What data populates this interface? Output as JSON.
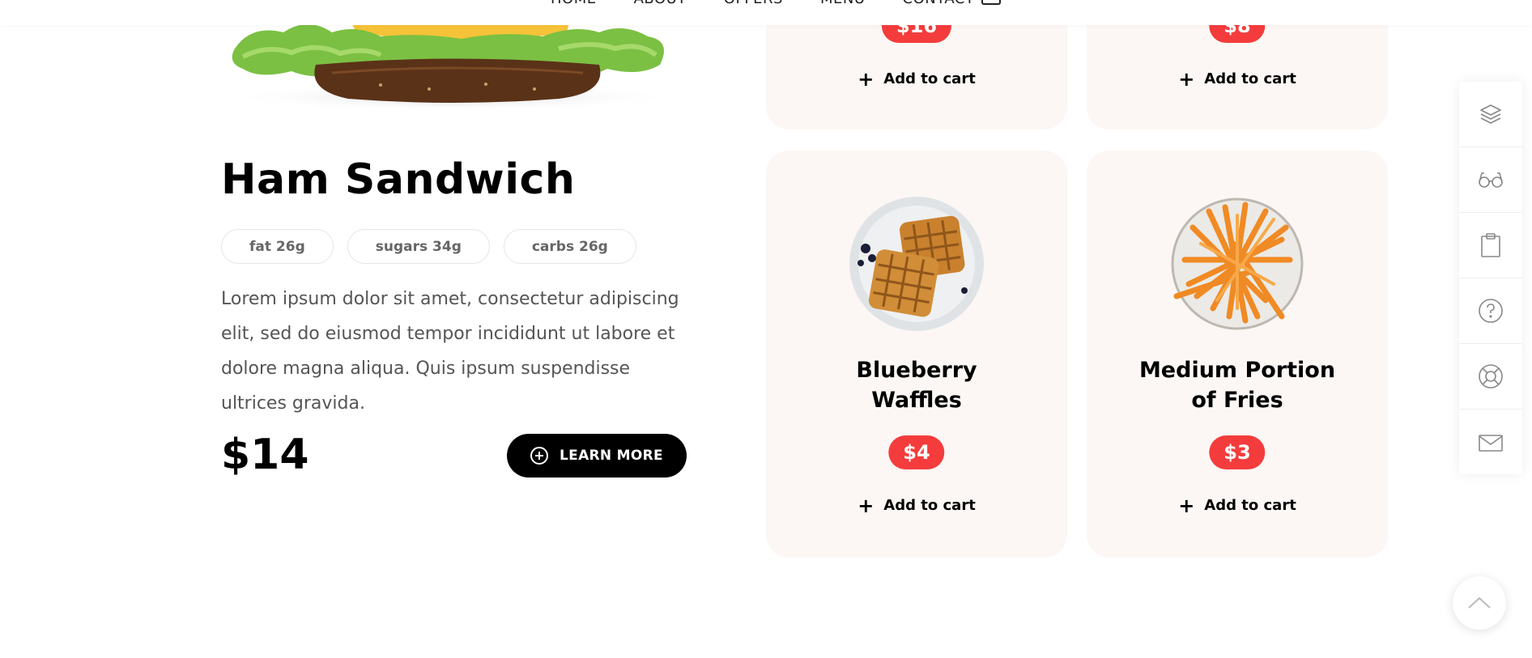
{
  "nav": {
    "items": [
      "HOME",
      "ABOUT",
      "OFFERS",
      "MENU",
      "CONTACT"
    ]
  },
  "hero": {
    "title": "Ham Sandwich",
    "tags": [
      "fat 26g",
      "sugars 34g",
      "carbs 26g"
    ],
    "description": "Lorem ipsum dolor sit amet, consectetur adipiscing elit, sed do eiusmod tempor incididunt ut labore et dolore magna aliqua. Quis ipsum suspendisse ultrices gravida.",
    "price": "$14",
    "button_label": "LEARN MORE"
  },
  "cards": [
    {
      "price": "$16",
      "cart_label": "Add to cart"
    },
    {
      "price": "$8",
      "cart_label": "Add to cart"
    },
    {
      "name_line1": "Blueberry",
      "name_line2": "Waffles",
      "price": "$4",
      "cart_label": "Add to cart"
    },
    {
      "name_line1": "Medium Portion",
      "name_line2": "of Fries",
      "price": "$3",
      "cart_label": "Add to cart"
    }
  ],
  "sidebar": {
    "icons": [
      "layers-icon",
      "glasses-icon",
      "clipboard-icon",
      "help-icon",
      "lifebuoy-icon",
      "mail-icon"
    ]
  },
  "colors": {
    "accent": "#f43c3c",
    "card_bg": "#fcf7f4",
    "button_bg": "#000000"
  }
}
